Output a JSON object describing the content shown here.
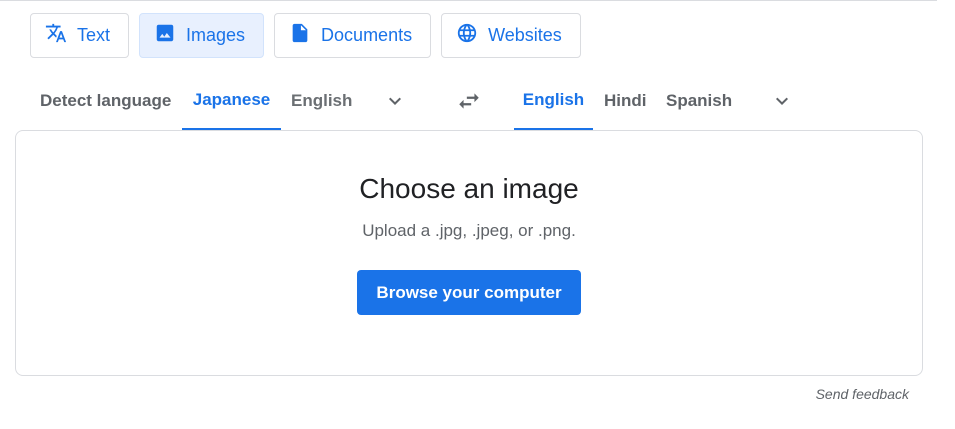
{
  "modes": [
    {
      "label": "Text",
      "icon": "translate-icon",
      "active": false
    },
    {
      "label": "Images",
      "icon": "image-icon",
      "active": true
    },
    {
      "label": "Documents",
      "icon": "document-icon",
      "active": false
    },
    {
      "label": "Websites",
      "icon": "globe-icon",
      "active": false
    }
  ],
  "source_languages": [
    "Detect language",
    "Japanese",
    "English"
  ],
  "source_selected": "Japanese",
  "target_languages": [
    "English",
    "Hindi",
    "Spanish"
  ],
  "target_selected": "English",
  "upload": {
    "title": "Choose an image",
    "subtitle": "Upload a .jpg, .jpeg, or .png.",
    "button_label": "Browse your computer"
  },
  "feedback_label": "Send feedback",
  "colors": {
    "accent": "#1a73e8",
    "active_tab_bg": "#e8f0fe"
  }
}
